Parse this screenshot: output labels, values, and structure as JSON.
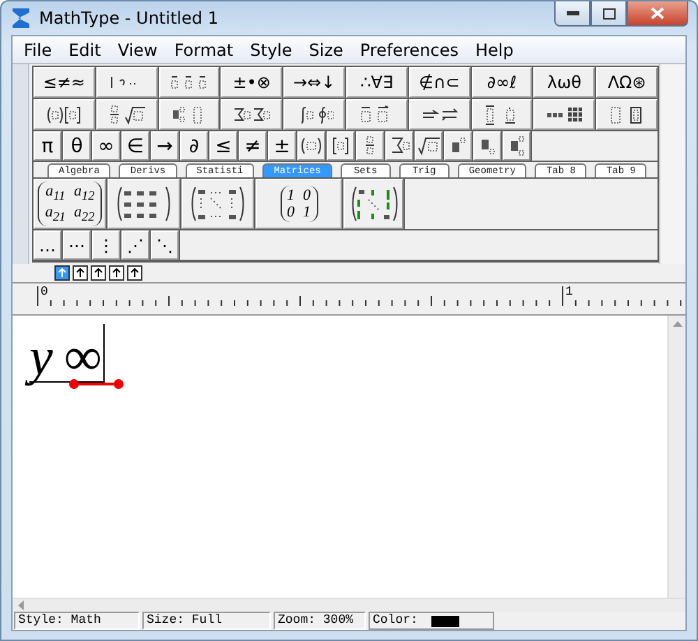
{
  "window": {
    "title": "MathType - Untitled 1"
  },
  "menu": [
    "File",
    "Edit",
    "View",
    "Format",
    "Style",
    "Size",
    "Preferences",
    "Help"
  ],
  "palette_rows": [
    [
      {
        "kind": "symbols",
        "label": "≤≠≈"
      },
      {
        "kind": "template"
      },
      {
        "kind": "template"
      },
      {
        "kind": "symbols",
        "label": "±•⊗"
      },
      {
        "kind": "symbols",
        "label": "→⇔↓"
      },
      {
        "kind": "symbols",
        "label": "∴∀∃"
      },
      {
        "kind": "symbols",
        "label": "∉∩⊂"
      },
      {
        "kind": "symbols",
        "label": "∂∞ℓ"
      },
      {
        "kind": "symbols",
        "label": "λωθ"
      },
      {
        "kind": "symbols",
        "label": "ΛΩ⊛"
      }
    ],
    [
      {
        "kind": "template"
      },
      {
        "kind": "template"
      },
      {
        "kind": "template"
      },
      {
        "kind": "template"
      },
      {
        "kind": "template"
      },
      {
        "kind": "template"
      },
      {
        "kind": "template"
      },
      {
        "kind": "template"
      },
      {
        "kind": "template"
      },
      {
        "kind": "template"
      }
    ]
  ],
  "small_bar": [
    {
      "kind": "symbols",
      "label": "π"
    },
    {
      "kind": "symbols",
      "label": "θ"
    },
    {
      "kind": "symbols",
      "label": "∞"
    },
    {
      "kind": "symbols",
      "label": "∈"
    },
    {
      "kind": "symbols",
      "label": "→"
    },
    {
      "kind": "symbols",
      "label": "∂"
    },
    {
      "kind": "symbols",
      "label": "≤"
    },
    {
      "kind": "symbols",
      "label": "≠"
    },
    {
      "kind": "symbols",
      "label": "±"
    },
    {
      "kind": "template"
    },
    {
      "kind": "template"
    },
    {
      "kind": "template"
    },
    {
      "kind": "template"
    },
    {
      "kind": "template"
    },
    {
      "kind": "template"
    },
    {
      "kind": "template"
    },
    {
      "kind": "template"
    }
  ],
  "tabs": [
    {
      "label": "Algebra",
      "selected": false
    },
    {
      "label": "Derivs",
      "selected": false
    },
    {
      "label": "Statisti",
      "selected": false
    },
    {
      "label": "Matrices",
      "selected": true
    },
    {
      "label": "Sets",
      "selected": false
    },
    {
      "label": "Trig",
      "selected": false
    },
    {
      "label": "Geometry",
      "selected": false
    },
    {
      "label": "Tab 8",
      "selected": false
    },
    {
      "label": "Tab 9",
      "selected": false
    }
  ],
  "templates": [
    {
      "kind": "matrix",
      "cells": [
        "a$_{11}$",
        "a$_{12}$",
        "a$_{21}$",
        "a$_{22}$"
      ]
    },
    {
      "kind": "template"
    },
    {
      "kind": "template"
    },
    {
      "kind": "matrix",
      "cells": [
        "1",
        "0",
        "0",
        "1"
      ]
    },
    {
      "kind": "template"
    }
  ],
  "dots": [
    "…",
    "⋯",
    "⋮",
    "⋰",
    "⋱"
  ],
  "alignment_buttons": [
    {
      "selected": true
    },
    {
      "selected": false
    },
    {
      "selected": false
    },
    {
      "selected": false
    },
    {
      "selected": false
    }
  ],
  "ruler": {
    "labels": [
      "0",
      "1"
    ]
  },
  "equation": [
    "y",
    "∞"
  ],
  "status_bar": {
    "style": "Style: Math",
    "size": "Size: Full",
    "zoom": "Zoom: 300%",
    "color_label": "Color:",
    "color": "#000000"
  }
}
